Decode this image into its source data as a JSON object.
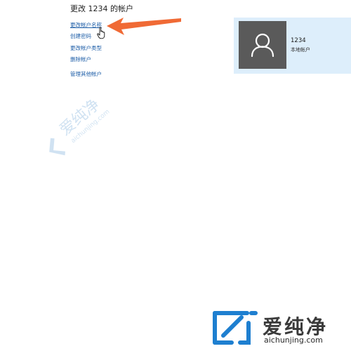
{
  "panel": {
    "title": "更改 1234 的帐户",
    "links": [
      {
        "label": "更改帐户名称"
      },
      {
        "label": "创建密码"
      },
      {
        "label": "更改帐户类型"
      },
      {
        "label": "删除帐户"
      },
      {
        "label": "管理其他帐户"
      }
    ]
  },
  "account": {
    "name": "1234",
    "type": "本地帐户"
  },
  "watermark": {
    "brand": "爱纯净",
    "url": "aichunjing.com"
  },
  "colors": {
    "link": "#1f5fa8",
    "card_bg": "#ddeefb",
    "avatar_bg": "#5a5a5a",
    "arrow": "#f06a35"
  },
  "icons": {
    "avatar": "user-silhouette-icon",
    "cursor": "hand-pointer-icon",
    "logo": "aichunjing-logo-icon"
  }
}
